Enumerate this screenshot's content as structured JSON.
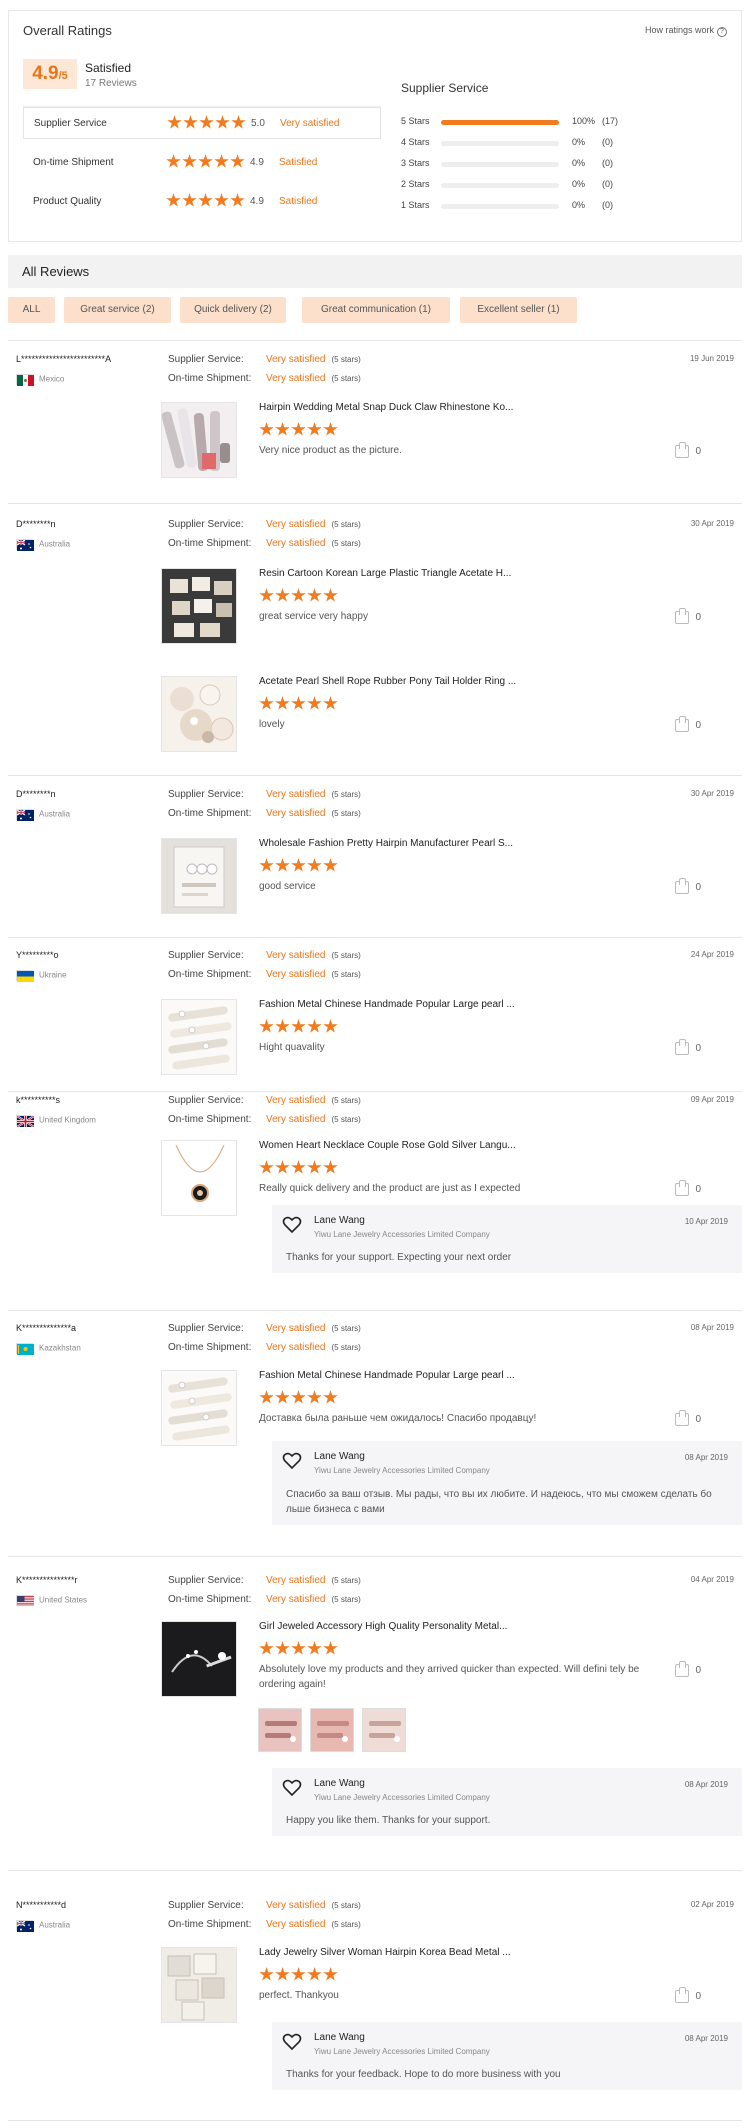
{
  "overall": {
    "title": "Overall Ratings",
    "how_link": "How ratings work",
    "score": "4.9",
    "score_denominator": "/5",
    "score_label": "Satisfied",
    "review_count": "17 Reviews",
    "metrics": [
      {
        "label": "Supplier Service",
        "value": "5.0",
        "desc": "Very satisfied"
      },
      {
        "label": "On-time Shipment",
        "value": "4.9",
        "desc": "Satisfied"
      },
      {
        "label": "Product Quality",
        "value": "4.9",
        "desc": "Satisfied"
      }
    ],
    "distribution_title": "Supplier Service",
    "distribution": [
      {
        "stars": "5 Stars",
        "pct": "100%",
        "count": "(17)",
        "fraction": 1.0
      },
      {
        "stars": "4 Stars",
        "pct": "0%",
        "count": "(0)",
        "fraction": 0
      },
      {
        "stars": "3 Stars",
        "pct": "0%",
        "count": "(0)",
        "fraction": 0
      },
      {
        "stars": "2 Stars",
        "pct": "0%",
        "count": "(0)",
        "fraction": 0
      },
      {
        "stars": "1 Stars",
        "pct": "0%",
        "count": "(0)",
        "fraction": 0
      }
    ]
  },
  "reviews_header": {
    "title": "All Reviews",
    "filters": [
      "ALL",
      "Great service (2)",
      "Quick delivery (2)",
      "Great communication (1)",
      "Excellent seller (1)"
    ]
  },
  "labels": {
    "supplier_service": "Supplier Service:",
    "ontime_shipment": "On-time Shipment:",
    "very_satisfied": "Very satisfied",
    "five_stars": "(5 stars)"
  },
  "reviews": [
    {
      "reviewer": "L************************A",
      "country": "Mexico",
      "flag": "mx",
      "date": "19 Jun 2019",
      "products": [
        {
          "name": "Hairpin Wedding Metal Snap Duck Claw Rhinestone Ko...",
          "comment": "Very nice product as the picture.",
          "likes": "0",
          "thumb": "pins"
        }
      ]
    },
    {
      "reviewer": "D********n",
      "country": "Australia",
      "flag": "au",
      "date": "30 Apr 2019",
      "products": [
        {
          "name": "Resin Cartoon Korean Large Plastic Triangle Acetate H...",
          "comment": "great service very happy",
          "likes": "0",
          "thumb": "clips"
        },
        {
          "name": "Acetate Pearl Shell Rope Rubber Pony Tail Holder Ring ...",
          "comment": "lovely",
          "likes": "0",
          "thumb": "pearl"
        }
      ]
    },
    {
      "reviewer": "D********n",
      "country": "Australia",
      "flag": "au",
      "date": "30 Apr 2019",
      "products": [
        {
          "name": "Wholesale Fashion Pretty Hairpin Manufacturer Pearl S...",
          "comment": "good service",
          "likes": "0",
          "thumb": "card"
        }
      ]
    },
    {
      "reviewer": "Y*********o",
      "country": "Ukraine",
      "flag": "ua",
      "date": "24 Apr 2019",
      "products": [
        {
          "name": "Fashion Metal Chinese Handmade Popular Large pearl ...",
          "comment": "Hight quavality",
          "likes": "0",
          "thumb": "pearlclips"
        }
      ]
    },
    {
      "reviewer": "k**********s",
      "country": "United Kingdom",
      "flag": "gb",
      "date": "09 Apr 2019",
      "products": [
        {
          "name": "Women Heart Necklace Couple Rose Gold Silver Langu...",
          "comment": "Really quick delivery and the product are just as I expected",
          "likes": "0",
          "thumb": "necklace"
        }
      ],
      "reply": {
        "name": "Lane Wang",
        "company": "Yiwu Lane Jewelry Accessories Limited Company",
        "date": "10 Apr 2019",
        "message": "Thanks for your support. Expecting your next order"
      }
    },
    {
      "reviewer": "K**************a",
      "country": "Kazakhstan",
      "flag": "kz",
      "date": "08 Apr 2019",
      "products": [
        {
          "name": "Fashion Metal Chinese Handmade Popular Large pearl ...",
          "comment": "Доставка была раньше чем ожидалось! Спасибо продавцу!",
          "likes": "0",
          "thumb": "pearlclips"
        }
      ],
      "reply": {
        "name": "Lane Wang",
        "company": "Yiwu Lane Jewelry Accessories Limited Company",
        "date": "08 Apr 2019",
        "message": "Спасибо за ваш отзыв. Мы рады, что вы их любите. И надеюсь, что мы сможем сделать бо льше бизнеса с вами"
      }
    },
    {
      "reviewer": "K***************r",
      "country": "United States",
      "flag": "us",
      "date": "04 Apr 2019",
      "products": [
        {
          "name": "Girl Jeweled Accessory High Quality Personality Metal...",
          "comment": "Absolutely love my products and they arrived quicker than expected. Will defini tely be ordering again!",
          "likes": "0",
          "thumb": "dark"
        }
      ],
      "reply": {
        "name": "Lane Wang",
        "company": "Yiwu Lane Jewelry Accessories Limited Company",
        "date": "08 Apr 2019",
        "message": "Happy you like them. Thanks for your support."
      }
    },
    {
      "reviewer": "N***********d",
      "country": "Australia",
      "flag": "au",
      "date": "02 Apr 2019",
      "products": [
        {
          "name": "Lady Jewelry Silver Woman Hairpin Korea Bead Metal ...",
          "comment": "perfect. Thankyou",
          "likes": "0",
          "thumb": "silver"
        }
      ],
      "reply": {
        "name": "Lane Wang",
        "company": "Yiwu Lane Jewelry Accessories Limited Company",
        "date": "08 Apr 2019",
        "message": "Thanks for your feedback. Hope to do more business with you"
      }
    }
  ]
}
